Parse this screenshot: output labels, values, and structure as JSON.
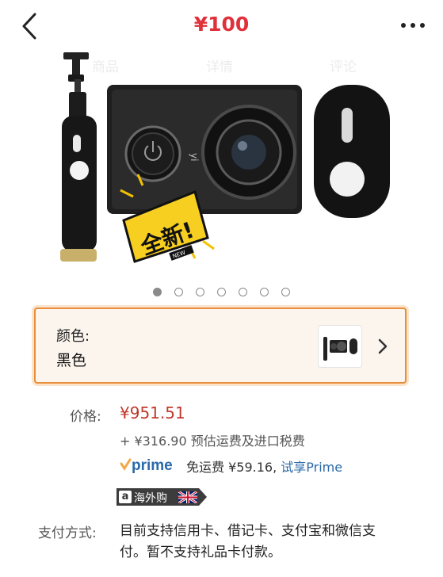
{
  "header": {
    "price": "¥100",
    "back_icon": "chevron-left-icon",
    "more_icon": "more-dots-icon"
  },
  "tabs": [
    "商品",
    "详情",
    "评论"
  ],
  "gallery": {
    "image_count": 7,
    "active_index": 0,
    "sticker_text": "全新!",
    "sticker_sub": "NEW"
  },
  "variant": {
    "label": "颜色:",
    "value": "黑色",
    "accent": "#e88d39"
  },
  "pricing": {
    "label": "价格:",
    "price": "¥951.51",
    "fees": "+ ¥316.90 预估运费及进口税费",
    "prime_logo": "prime",
    "prime_shipping": "免运费 ¥59.16,",
    "prime_try": "试享Prime",
    "badge_text": "海外购",
    "badge_flag": "uk-flag-icon",
    "price_color": "#c0392b",
    "link_color": "#2a6aa8"
  },
  "payment": {
    "label": "支付方式:",
    "text": "目前支持信用卡、借记卡、支付宝和微信支付。暂不支持礼品卡付款。"
  }
}
